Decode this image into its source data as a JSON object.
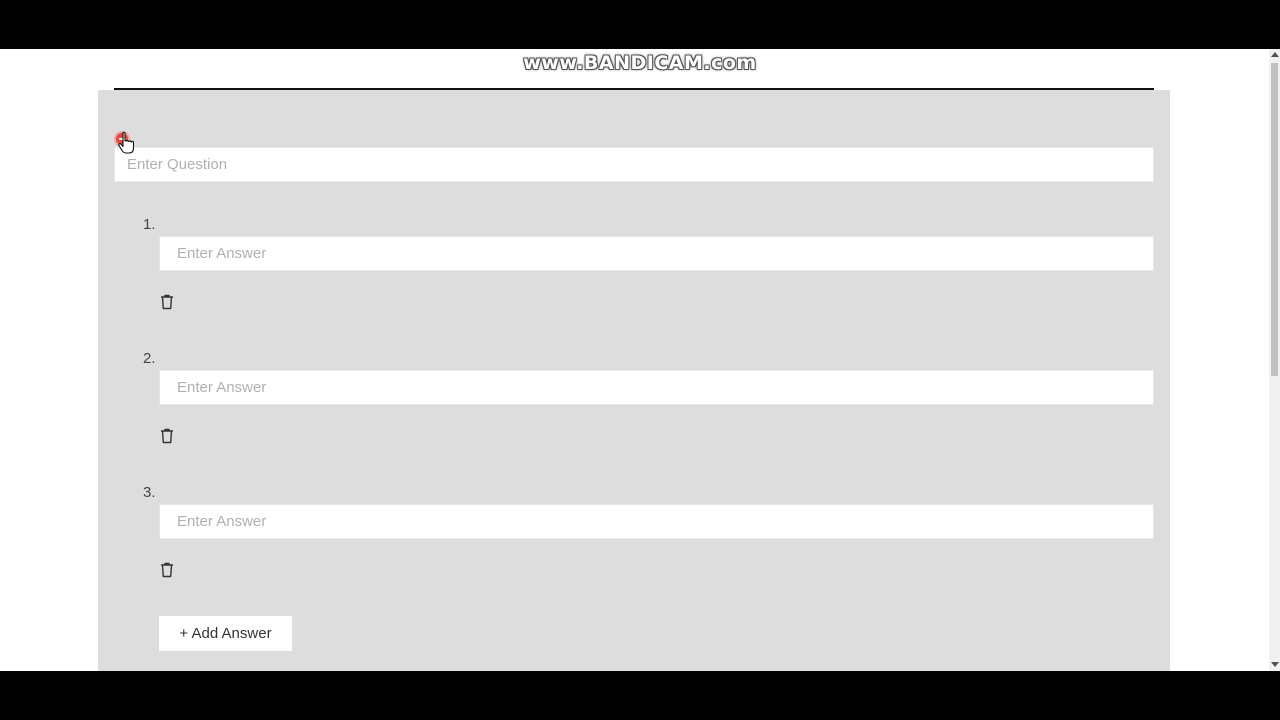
{
  "watermark": "www.BANDICAM.com",
  "question": {
    "placeholder": "Enter Question",
    "value": ""
  },
  "answers": [
    {
      "number": "1.",
      "placeholder": "Enter Answer",
      "value": ""
    },
    {
      "number": "2.",
      "placeholder": "Enter Answer",
      "value": ""
    },
    {
      "number": "3.",
      "placeholder": "Enter Answer",
      "value": ""
    }
  ],
  "add_answer_label": "+ Add Answer",
  "icons": {
    "remove_question": "minus-circle-icon",
    "delete_answer": "trash-icon",
    "cursor": "hand-pointer-icon"
  },
  "colors": {
    "card_bg": "#dddddd",
    "remove_red": "#e5483f",
    "placeholder": "#b0b0b0"
  }
}
